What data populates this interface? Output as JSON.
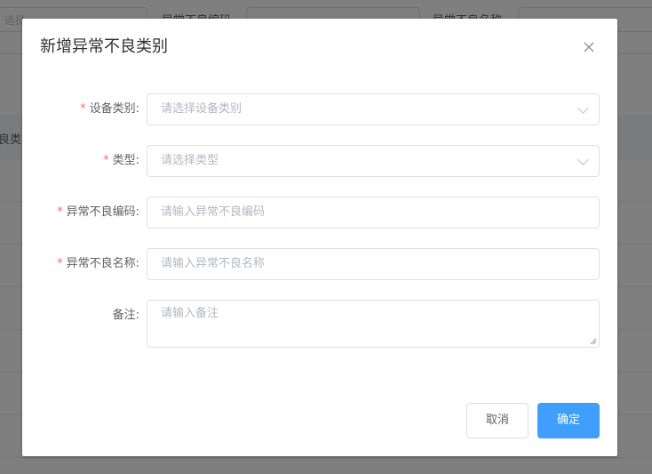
{
  "background": {
    "filter": {
      "select_placeholder": "选择",
      "label_code": "异常不良编码",
      "label_name": "异常不良名称"
    },
    "table_header_text": "良类"
  },
  "dialog": {
    "title": "新增异常不良类别",
    "close_icon": "close-icon",
    "fields": [
      {
        "label": "设备类别:",
        "required": true,
        "type": "select",
        "placeholder": "请选择设备类别"
      },
      {
        "label": "类型:",
        "required": true,
        "type": "select",
        "placeholder": "请选择类型"
      },
      {
        "label": "异常不良编码:",
        "required": true,
        "type": "input",
        "placeholder": "请输入异常不良编码"
      },
      {
        "label": "异常不良名称:",
        "required": true,
        "type": "input",
        "placeholder": "请输入异常不良名称"
      },
      {
        "label": "备注:",
        "required": false,
        "type": "textarea",
        "placeholder": "请输入备注"
      }
    ],
    "required_mark": "*",
    "buttons": {
      "cancel": "取消",
      "confirm": "确定"
    }
  },
  "colors": {
    "primary": "#409eff",
    "required": "#f56c6c",
    "overlay": "rgba(0,0,0,0.5)"
  }
}
